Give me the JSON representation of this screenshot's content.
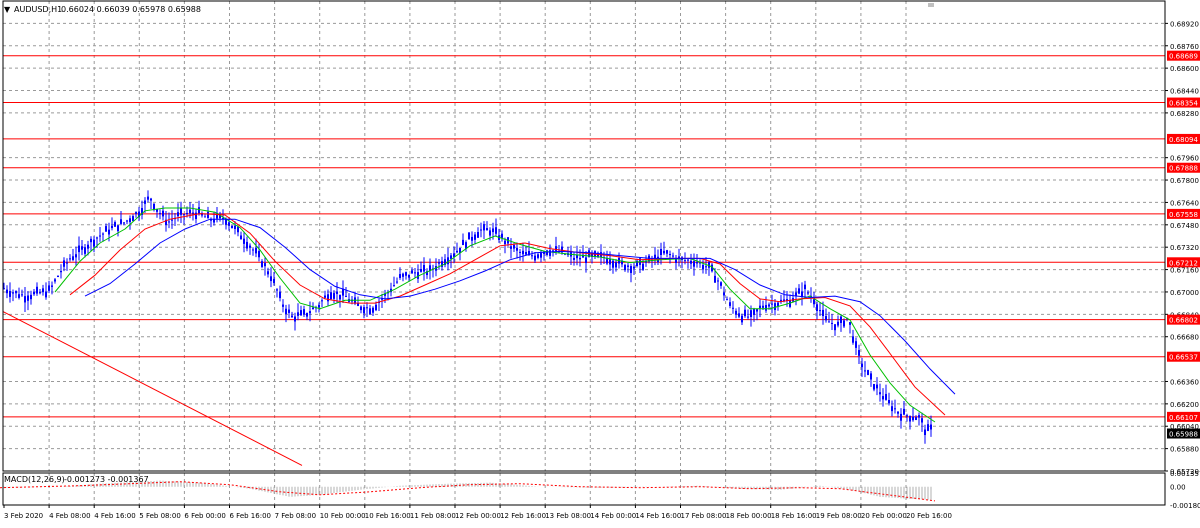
{
  "header": {
    "dropdown_glyph": "▼",
    "symbol": "AUDUSD,H1",
    "ohlc": "0.66024 0.66039 0.65978 0.65988"
  },
  "macd_header": {
    "label": "MACD(12,26,9)",
    "values": "-0.001273 -0.001367"
  },
  "colors": {
    "background": "#ffffff",
    "grid": "#9a9a9a",
    "frame": "#000000",
    "candles": "#0000ff",
    "level_lines": "#ff0000",
    "ma_fast": "#00c000",
    "ma_mid": "#ff0000",
    "ma_slow": "#0000ff",
    "macd_histogram": "#b0b0b0",
    "macd_signal": "#ff0000",
    "tag_fill": "#ff0000",
    "current_price_tag": "#000000"
  },
  "chart_data": {
    "type": "line",
    "instrument": "AUDUSD",
    "timeframe": "H1",
    "ylim": [
      0.6572,
      0.6908
    ],
    "grid": true,
    "price_ticks": [
      "0.68920",
      "0.68760",
      "0.68600",
      "0.68440",
      "0.68280",
      "0.67960",
      "0.67800",
      "0.67640",
      "0.67480",
      "0.67320",
      "0.67160",
      "0.67000",
      "0.66840",
      "0.66680",
      "0.66360",
      "0.66200",
      "0.66040",
      "0.65880",
      "0.65720"
    ],
    "time_labels": [
      "3 Feb 2020",
      "4 Feb 08:00",
      "4 Feb 16:00",
      "5 Feb 08:00",
      "6 Feb 00:00",
      "6 Feb 16:00",
      "7 Feb 08:00",
      "10 Feb 00:00",
      "10 Feb 16:00",
      "11 Feb 08:00",
      "12 Feb 00:00",
      "12 Feb 16:00",
      "13 Feb 08:00",
      "14 Feb 00:00",
      "14 Feb 16:00",
      "17 Feb 08:00",
      "18 Feb 00:00",
      "18 Feb 16:00",
      "19 Feb 08:00",
      "20 Feb 00:00",
      "20 Feb 16:00"
    ],
    "horizontal_levels": [
      "0.68689",
      "0.68354",
      "0.68094",
      "0.67888",
      "0.67558",
      "0.67212",
      "0.66802",
      "0.66537",
      "0.66107"
    ],
    "current_price": "0.65988",
    "close_path": [
      [
        0,
        0.6704
      ],
      [
        12,
        0.67
      ],
      [
        25,
        0.6697
      ],
      [
        38,
        0.6699
      ],
      [
        50,
        0.6701
      ],
      [
        60,
        0.6714
      ],
      [
        70,
        0.6724
      ],
      [
        80,
        0.6729
      ],
      [
        95,
        0.6738
      ],
      [
        110,
        0.6745
      ],
      [
        125,
        0.675
      ],
      [
        140,
        0.6758
      ],
      [
        150,
        0.6768
      ],
      [
        158,
        0.6758
      ],
      [
        168,
        0.675
      ],
      [
        180,
        0.6755
      ],
      [
        195,
        0.6757
      ],
      [
        210,
        0.6752
      ],
      [
        225,
        0.6753
      ],
      [
        235,
        0.6745
      ],
      [
        248,
        0.6735
      ],
      [
        262,
        0.6722
      ],
      [
        272,
        0.671
      ],
      [
        282,
        0.6692
      ],
      [
        292,
        0.6682
      ],
      [
        305,
        0.6684
      ],
      [
        318,
        0.669
      ],
      [
        330,
        0.67
      ],
      [
        345,
        0.6697
      ],
      [
        358,
        0.669
      ],
      [
        372,
        0.6688
      ],
      [
        386,
        0.6698
      ],
      [
        400,
        0.671
      ],
      [
        415,
        0.6714
      ],
      [
        430,
        0.6715
      ],
      [
        442,
        0.6722
      ],
      [
        455,
        0.6728
      ],
      [
        468,
        0.6737
      ],
      [
        480,
        0.6744
      ],
      [
        490,
        0.6744
      ],
      [
        500,
        0.674
      ],
      [
        512,
        0.6732
      ],
      [
        522,
        0.6727
      ],
      [
        535,
        0.6726
      ],
      [
        548,
        0.673
      ],
      [
        560,
        0.6729
      ],
      [
        575,
        0.6724
      ],
      [
        590,
        0.6725
      ],
      [
        605,
        0.6725
      ],
      [
        620,
        0.672
      ],
      [
        635,
        0.6718
      ],
      [
        650,
        0.6722
      ],
      [
        665,
        0.6728
      ],
      [
        680,
        0.6723
      ],
      [
        695,
        0.6722
      ],
      [
        710,
        0.6717
      ],
      [
        720,
        0.6706
      ],
      [
        730,
        0.669
      ],
      [
        742,
        0.6683
      ],
      [
        752,
        0.6682
      ],
      [
        762,
        0.669
      ],
      [
        775,
        0.6692
      ],
      [
        790,
        0.6694
      ],
      [
        805,
        0.6702
      ],
      [
        815,
        0.6694
      ],
      [
        825,
        0.668
      ],
      [
        838,
        0.6676
      ],
      [
        848,
        0.6682
      ],
      [
        856,
        0.666
      ],
      [
        864,
        0.6645
      ],
      [
        876,
        0.6632
      ],
      [
        888,
        0.6621
      ],
      [
        900,
        0.6613
      ],
      [
        912,
        0.6611
      ],
      [
        920,
        0.661
      ],
      [
        926,
        0.66
      ],
      [
        932,
        0.6602
      ]
    ],
    "series": [
      {
        "values": [
          [
            55,
            0.67
          ],
          [
            80,
            0.6722
          ],
          [
            100,
            0.6735
          ],
          [
            125,
            0.6745
          ],
          [
            145,
            0.6758
          ],
          [
            165,
            0.676
          ],
          [
            190,
            0.676
          ],
          [
            215,
            0.6757
          ],
          [
            240,
            0.6746
          ],
          [
            260,
            0.673
          ],
          [
            280,
            0.671
          ],
          [
            300,
            0.6692
          ],
          [
            320,
            0.6688
          ],
          [
            345,
            0.6694
          ],
          [
            370,
            0.6694
          ],
          [
            395,
            0.6702
          ],
          [
            420,
            0.6712
          ],
          [
            445,
            0.672
          ],
          [
            470,
            0.6733
          ],
          [
            495,
            0.674
          ],
          [
            520,
            0.6734
          ],
          [
            545,
            0.6729
          ],
          [
            570,
            0.6727
          ],
          [
            600,
            0.6725
          ],
          [
            630,
            0.6721
          ],
          [
            660,
            0.6723
          ],
          [
            690,
            0.6724
          ],
          [
            712,
            0.6718
          ],
          [
            730,
            0.6702
          ],
          [
            750,
            0.6688
          ],
          [
            770,
            0.6688
          ],
          [
            790,
            0.6692
          ],
          [
            810,
            0.6697
          ],
          [
            830,
            0.6688
          ],
          [
            850,
            0.668
          ],
          [
            870,
            0.6655
          ],
          [
            890,
            0.6635
          ],
          [
            910,
            0.6619
          ],
          [
            935,
            0.6607
          ]
        ]
      },
      {
        "values": [
          [
            70,
            0.6698
          ],
          [
            95,
            0.6712
          ],
          [
            120,
            0.673
          ],
          [
            145,
            0.6745
          ],
          [
            170,
            0.6752
          ],
          [
            200,
            0.6756
          ],
          [
            225,
            0.6755
          ],
          [
            250,
            0.6742
          ],
          [
            275,
            0.6722
          ],
          [
            300,
            0.6705
          ],
          [
            325,
            0.6695
          ],
          [
            350,
            0.6692
          ],
          [
            375,
            0.6692
          ],
          [
            400,
            0.6697
          ],
          [
            425,
            0.6705
          ],
          [
            450,
            0.6713
          ],
          [
            475,
            0.6723
          ],
          [
            500,
            0.6733
          ],
          [
            525,
            0.6735
          ],
          [
            550,
            0.6731
          ],
          [
            580,
            0.6728
          ],
          [
            610,
            0.6726
          ],
          [
            640,
            0.6723
          ],
          [
            670,
            0.6724
          ],
          [
            700,
            0.6724
          ],
          [
            720,
            0.672
          ],
          [
            740,
            0.6706
          ],
          [
            760,
            0.6695
          ],
          [
            780,
            0.6693
          ],
          [
            800,
            0.6695
          ],
          [
            825,
            0.6696
          ],
          [
            850,
            0.669
          ],
          [
            870,
            0.6675
          ],
          [
            890,
            0.6656
          ],
          [
            915,
            0.6632
          ],
          [
            945,
            0.6612
          ]
        ]
      },
      {
        "values": [
          [
            85,
            0.6697
          ],
          [
            110,
            0.6706
          ],
          [
            135,
            0.672
          ],
          [
            160,
            0.6735
          ],
          [
            185,
            0.6745
          ],
          [
            210,
            0.6752
          ],
          [
            235,
            0.6752
          ],
          [
            260,
            0.6746
          ],
          [
            285,
            0.6732
          ],
          [
            310,
            0.6716
          ],
          [
            335,
            0.6704
          ],
          [
            360,
            0.6698
          ],
          [
            385,
            0.6695
          ],
          [
            410,
            0.6697
          ],
          [
            435,
            0.6702
          ],
          [
            460,
            0.6708
          ],
          [
            485,
            0.6715
          ],
          [
            510,
            0.6723
          ],
          [
            535,
            0.6728
          ],
          [
            560,
            0.6729
          ],
          [
            590,
            0.6728
          ],
          [
            620,
            0.6726
          ],
          [
            650,
            0.6724
          ],
          [
            680,
            0.6724
          ],
          [
            710,
            0.6724
          ],
          [
            735,
            0.6716
          ],
          [
            760,
            0.6705
          ],
          [
            785,
            0.6698
          ],
          [
            810,
            0.6696
          ],
          [
            835,
            0.6697
          ],
          [
            860,
            0.6693
          ],
          [
            880,
            0.6683
          ],
          [
            905,
            0.6665
          ],
          [
            930,
            0.6645
          ],
          [
            955,
            0.6627
          ]
        ]
      }
    ],
    "macd": {
      "ylim": [
        -0.001807,
        0.001357
      ],
      "ticks": [
        "0.001357",
        "0.00",
        "-0.001807"
      ],
      "histogram_path": [
        [
          0,
          -0.0001
        ],
        [
          60,
          0.0
        ],
        [
          100,
          0.0003
        ],
        [
          160,
          0.0006
        ],
        [
          200,
          0.0004
        ],
        [
          250,
          -0.0002
        ],
        [
          290,
          -0.001
        ],
        [
          320,
          -0.0008
        ],
        [
          360,
          -0.0003
        ],
        [
          400,
          0.0001
        ],
        [
          450,
          0.0003
        ],
        [
          490,
          0.0004
        ],
        [
          540,
          0.0
        ],
        [
          600,
          -0.0001
        ],
        [
          660,
          0.0
        ],
        [
          700,
          0.0001
        ],
        [
          740,
          -0.0002
        ],
        [
          780,
          -0.0003
        ],
        [
          820,
          0.0001
        ],
        [
          850,
          -0.0003
        ],
        [
          880,
          -0.001
        ],
        [
          910,
          -0.0012
        ],
        [
          932,
          -0.0013
        ]
      ],
      "signal_path": [
        [
          0,
          -0.0001
        ],
        [
          80,
          0.0001
        ],
        [
          130,
          0.0003
        ],
        [
          180,
          0.0005
        ],
        [
          230,
          0.0002
        ],
        [
          280,
          -0.0005
        ],
        [
          320,
          -0.0008
        ],
        [
          370,
          -0.0005
        ],
        [
          420,
          -0.0001
        ],
        [
          470,
          0.0002
        ],
        [
          520,
          0.0003
        ],
        [
          580,
          0.0
        ],
        [
          640,
          -0.0001
        ],
        [
          700,
          0.0
        ],
        [
          750,
          -0.0002
        ],
        [
          800,
          -0.0001
        ],
        [
          840,
          -0.0002
        ],
        [
          880,
          -0.0007
        ],
        [
          920,
          -0.0012
        ],
        [
          935,
          -0.0014
        ]
      ]
    }
  }
}
